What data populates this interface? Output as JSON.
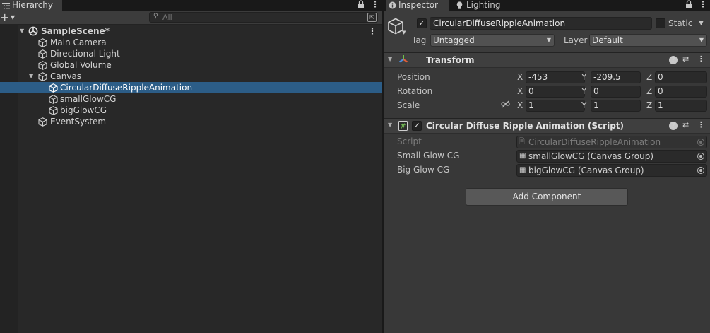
{
  "hierarchy": {
    "tab_label": "Hierarchy",
    "search_placeholder": "All",
    "scene_name": "SampleScene*",
    "items": [
      {
        "label": "Main Camera"
      },
      {
        "label": "Directional Light"
      },
      {
        "label": "Global Volume"
      },
      {
        "label": "Canvas"
      },
      {
        "label": "CircularDiffuseRippleAnimation"
      },
      {
        "label": "smallGlowCG"
      },
      {
        "label": "bigGlowCG"
      },
      {
        "label": "EventSystem"
      }
    ],
    "selected_index": 4,
    "selection_color": "#2c5d87"
  },
  "inspector": {
    "tab_label": "Inspector",
    "lighting_tab_label": "Lighting",
    "object_name": "CircularDiffuseRippleAnimation",
    "static_label": "Static",
    "tag_label": "Tag",
    "tag_value": "Untagged",
    "layer_label": "Layer",
    "layer_value": "Default",
    "transform": {
      "title": "Transform",
      "position_label": "Position",
      "rotation_label": "Rotation",
      "scale_label": "Scale",
      "axes": {
        "x": "X",
        "y": "Y",
        "z": "Z"
      },
      "position": {
        "x": "-453",
        "y": "-209.5",
        "z": "0"
      },
      "rotation": {
        "x": "0",
        "y": "0",
        "z": "0"
      },
      "scale": {
        "x": "1",
        "y": "1",
        "z": "1"
      }
    },
    "script_component": {
      "title": "Circular Diffuse Ripple Animation (Script)",
      "script_label": "Script",
      "script_value": "CircularDiffuseRippleAnimation",
      "small_glow_label": "Small Glow CG",
      "small_glow_value": "smallGlowCG (Canvas Group)",
      "big_glow_label": "Big Glow CG",
      "big_glow_value": "bigGlowCG (Canvas Group)"
    },
    "add_component_label": "Add Component"
  },
  "icons": [
    "hierarchy-icon",
    "lock-icon",
    "kebab-icon",
    "plus-icon",
    "search-icon",
    "unity-scene-icon",
    "gameobject-cube-icon",
    "info-icon",
    "lightbulb-icon",
    "transform-gizmo-icon",
    "help-icon",
    "preset-sliders-icon",
    "script-hash-icon",
    "link-constrain-icon",
    "canvas-group-icon",
    "object-picker-icon"
  ]
}
